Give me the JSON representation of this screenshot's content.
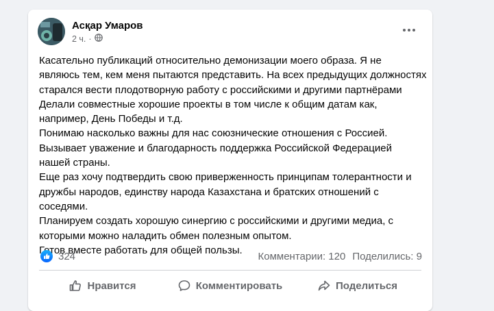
{
  "post": {
    "author": "Асқар Умаров",
    "timestamp": "2 ч.",
    "dot": "·",
    "text": "Касательно публикаций относительно демонизации моего образа. Я не\nявляюсь тем, кем меня пытаются представить. На всех предыдущих должностях\nстарался вести плодотворную работу с российскими и другими партнёрами\nДелали совместные хорошие проекты в том числе к общим датам как,\nнапример, День Победы и т.д.\nПонимаю насколько важны для  нас союзнические отношения с Россией.\nВызывает уважение и благодарность  поддержка Российской Федерацией\nнашей страны.\nЕще раз хочу подтвердить свою приверженность принципам толерантности и\nдружбы народов, единству народа Казахстана и братских отношений с\nсоседями.\nПланируем создать хорошую синергию с российскими и другими медиа, с\nкоторыми можно наладить обмен полезным опытом.\nГотов вместе работать для общей пользы."
  },
  "stats": {
    "reactions_count": "324",
    "comments": "Комментарии: 120",
    "shares": "Поделились: 9"
  },
  "actions": {
    "like": "Нравится",
    "comment": "Комментировать",
    "share": "Поделиться"
  },
  "icons": {
    "avatar": "avatar-image",
    "audience": "globe-icon",
    "more": "more-options-icon",
    "like_reaction": "thumbs-up-icon",
    "like_action": "thumbs-up-outline-icon",
    "comment_action": "speech-bubble-icon",
    "share_action": "share-arrow-icon"
  },
  "colors": {
    "like_blue": "#0866ff",
    "secondary_text": "#65676b",
    "primary_text": "#050505",
    "background": "#f0f2f5"
  }
}
